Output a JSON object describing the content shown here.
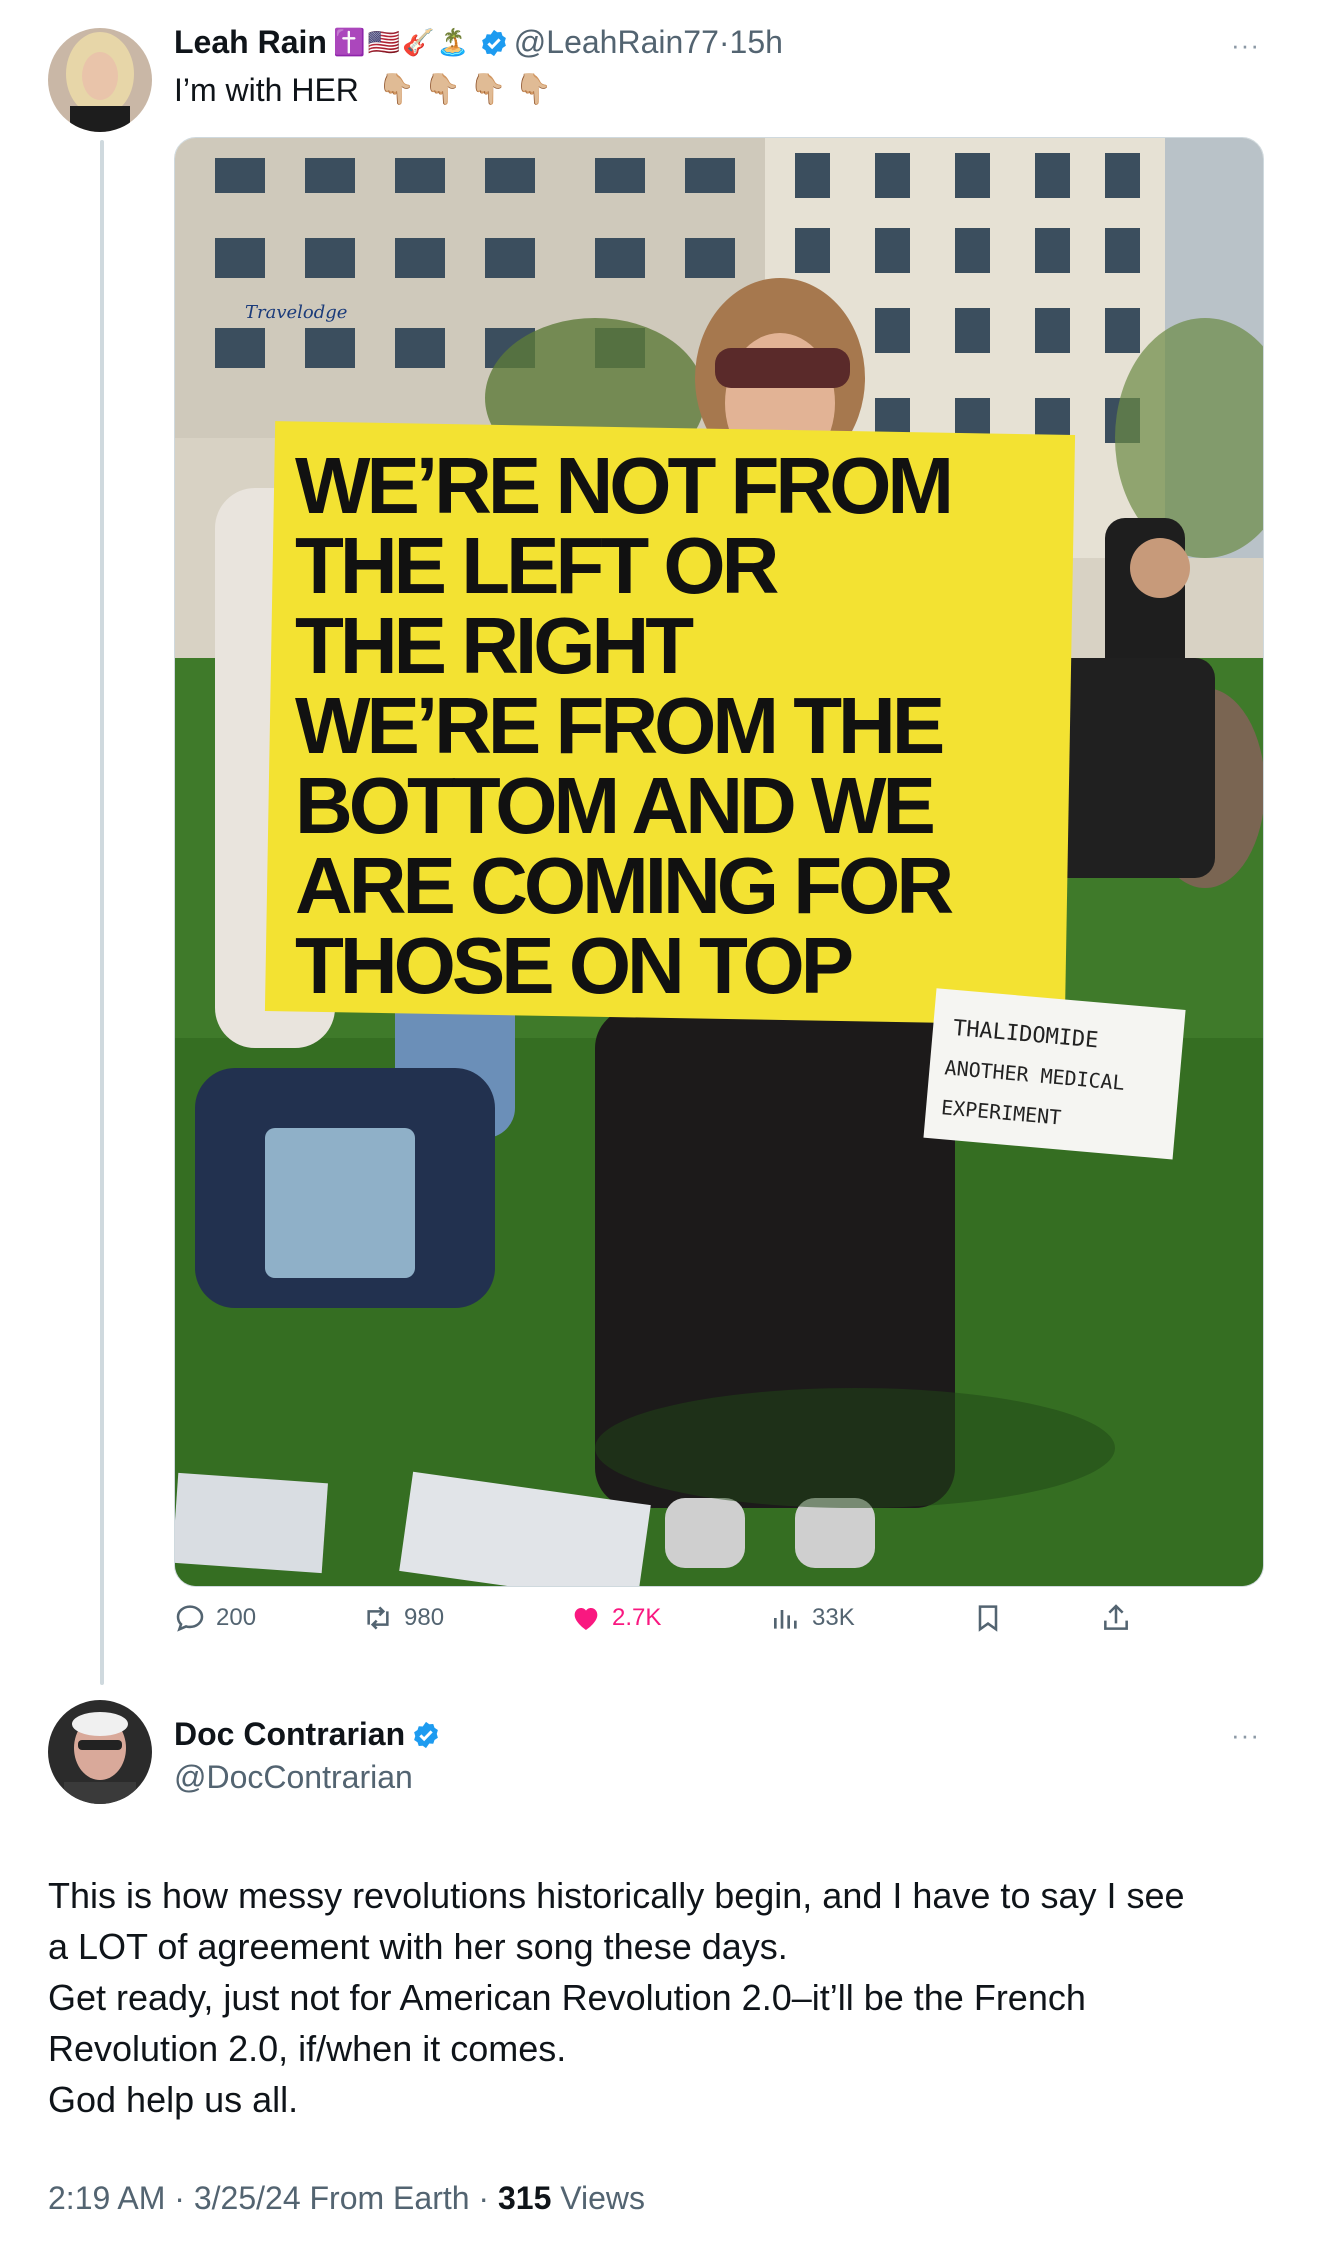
{
  "post": {
    "author_name": "Leah Rain",
    "author_emojis": [
      "✝️",
      "🇺🇸",
      "🎸",
      "🏝️"
    ],
    "handle": "@LeahRain77",
    "separator": "·",
    "time": "15h",
    "text": "I’m with HER",
    "text_emojis": "👇🏼 👇🏼 👇🏼 👇🏼",
    "more": "···",
    "media": {
      "sign_lines": [
        "WE’RE NOT FROM",
        "THE LEFT OR",
        "THE RIGHT",
        "WE’RE FROM THE",
        "BOTTOM AND WE",
        "ARE COMING FOR",
        "THOSE ON TOP"
      ],
      "second_sign_lines": [
        "THALIDOMIDE",
        "ANOTHER MEDICAL",
        "EXPERIMENT"
      ],
      "hotel_sign": "Travelodge"
    },
    "stats": {
      "replies": "200",
      "reposts": "980",
      "likes": "2.7K",
      "views": "33K"
    },
    "icons": [
      "reply-icon",
      "repost-icon",
      "heart-icon",
      "views-icon",
      "bookmark-icon",
      "share-icon"
    ],
    "like_color": "#f91880"
  },
  "reply": {
    "author_name": "Doc Contrarian",
    "handle": "@DocContrarian",
    "more": "···",
    "lines": [
      "This is how messy revolutions historically begin, and I have to say I see",
      "a LOT of agreement with her song these days.",
      "Get ready, just not for American Revolution 2.0–it’ll be the French",
      "Revolution 2.0, if/when it comes.",
      "God help us all."
    ],
    "meta": {
      "time": "2:19 AM",
      "date": "3/25/24",
      "source": "From Earth",
      "views_count": "315",
      "views_label": "Views"
    }
  },
  "colors": {
    "verified": "#1d9bf0",
    "secondary_text": "#536471",
    "sign_yellow": "#f3e232"
  }
}
